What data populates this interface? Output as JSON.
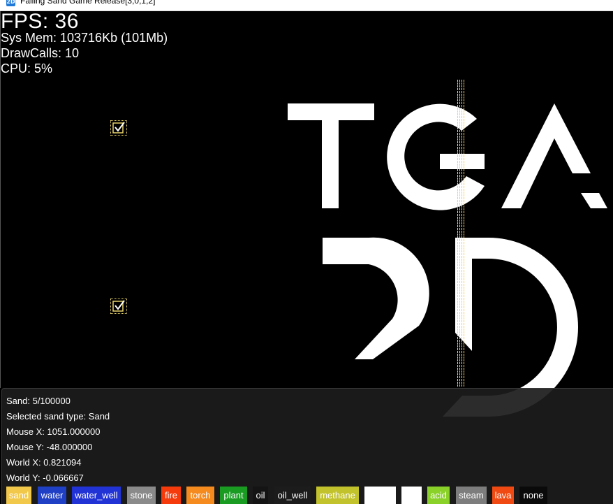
{
  "window": {
    "title": "Falling Sand Game Release[3,0,1,2]",
    "icon": "app-2d-icon"
  },
  "stats": {
    "fps": "FPS: 36",
    "sys_mem": "Sys Mem: 103716Kb (101Mb)",
    "draw_calls": "DrawCalls: 10",
    "cpu": "CPU: 5%"
  },
  "logo": {
    "text": "TGA 2D"
  },
  "info": {
    "sand": "Sand: 5/100000",
    "selected_type": "Selected sand type:   Sand",
    "mouse_x": "Mouse X: 1051.000000",
    "mouse_y": "Mouse Y: -48.000000",
    "world_x": "World X: 0.821094",
    "world_y": "World Y: -0.066667"
  },
  "sand_types": [
    {
      "label": "sand",
      "bg": "#f2c84b",
      "fg": "#ffffff"
    },
    {
      "label": "water",
      "bg": "#1f3fc4",
      "fg": "#ffffff"
    },
    {
      "label": "water_well",
      "bg": "#2233d6",
      "fg": "#ffffff"
    },
    {
      "label": "stone",
      "bg": "#8a8a8a",
      "fg": "#ffffff"
    },
    {
      "label": "fire",
      "bg": "#f53a0b",
      "fg": "#ffffff"
    },
    {
      "label": "torch",
      "bg": "#f58a1e",
      "fg": "#ffffff"
    },
    {
      "label": "plant",
      "bg": "#1a9c22",
      "fg": "#ffffff"
    },
    {
      "label": "oil",
      "bg": "#141414",
      "fg": "#ffffff"
    },
    {
      "label": "oil_well",
      "bg": "#1c1c1c",
      "fg": "#ffffff"
    },
    {
      "label": "methane",
      "bg": "#c2c22c",
      "fg": "#ffffff"
    },
    {
      "label": "",
      "bg": "#ffffff",
      "fg": "#ffffff"
    },
    {
      "label": "",
      "bg": "#ffffff",
      "fg": "#ffffff"
    },
    {
      "label": "acid",
      "bg": "#8ad22a",
      "fg": "#ffffff"
    },
    {
      "label": "steam",
      "bg": "#7d7d7d",
      "fg": "#ffffff"
    },
    {
      "label": "lava",
      "bg": "#f04a12",
      "fg": "#ffffff"
    },
    {
      "label": "none",
      "bg": "#0a0a0a",
      "fg": "#ffffff"
    }
  ],
  "colors": {
    "checkbox": "#e8d36a",
    "sand_stream": "#f2d36b"
  }
}
